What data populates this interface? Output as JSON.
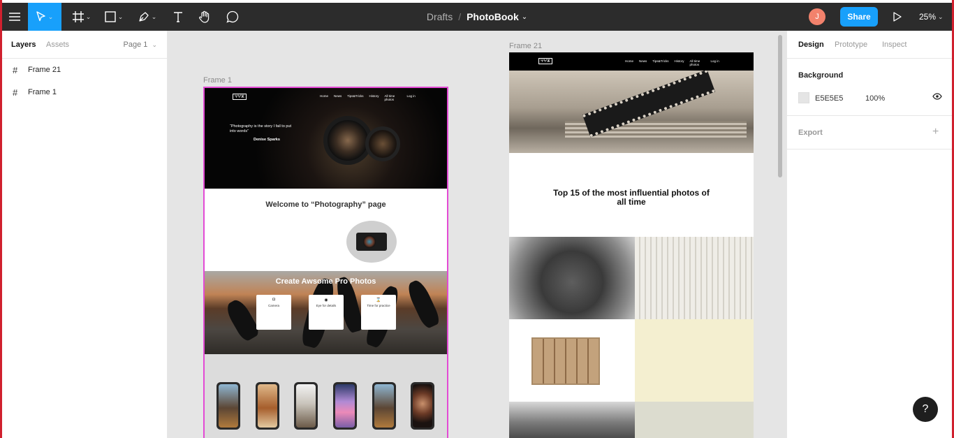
{
  "toolbar": {
    "breadcrumb_root": "Drafts",
    "separator": "/",
    "file_name": "PhotoBook",
    "avatar_initial": "J",
    "share_label": "Share",
    "zoom_level": "25%",
    "caret": "⌄",
    "tools": [
      "menu-icon",
      "move-tool-icon",
      "frame-tool-icon",
      "rectangle-tool-icon",
      "pen-tool-icon",
      "text-tool-icon",
      "hand-tool-icon",
      "comment-tool-icon"
    ],
    "accent_color": "#18a0fb"
  },
  "left_panel": {
    "tabs": [
      "Layers",
      "Assets"
    ],
    "page": "Page 1",
    "page_caret": "⌄",
    "layers": [
      {
        "name": "Frame 21",
        "icon": "#"
      },
      {
        "name": "Frame 1",
        "icon": "#"
      }
    ]
  },
  "right_panel": {
    "tabs": [
      "Design",
      "Prototype",
      "Inspect"
    ],
    "background_label": "Background",
    "background_hex": "E5E5E5",
    "background_opacity": "100%",
    "export_label": "Export",
    "export_add": "+"
  },
  "canvas": {
    "frame1": {
      "label": "Frame 1",
      "logo": "ⵖⵖⵣ",
      "nav": [
        "Home",
        "News",
        "Tips&Tricks",
        "History",
        "All time photos",
        "Log in"
      ],
      "quote": "“Photography is the story I fail to put into words”",
      "quote_author": "Denise Sparks",
      "welcome": "Welcome to “Photography” page",
      "section_title": "Create Awsome Pro Photos",
      "cards": [
        {
          "icon": "camera-icon",
          "glyph": "◘",
          "label": "Camera"
        },
        {
          "icon": "eye-icon",
          "glyph": "◉",
          "label": "Eye for details"
        },
        {
          "icon": "hourglass-icon",
          "glyph": "⌛",
          "label": "Time for practice"
        }
      ]
    },
    "frame21": {
      "label": "Frame 21",
      "logo": "ⵖⵖⵣ",
      "nav": [
        "Home",
        "News",
        "Tips&Tricks",
        "History",
        "All time photos",
        "Log in"
      ],
      "headline": "Top 15 of the most influential photos of all time"
    }
  },
  "help_label": "?"
}
